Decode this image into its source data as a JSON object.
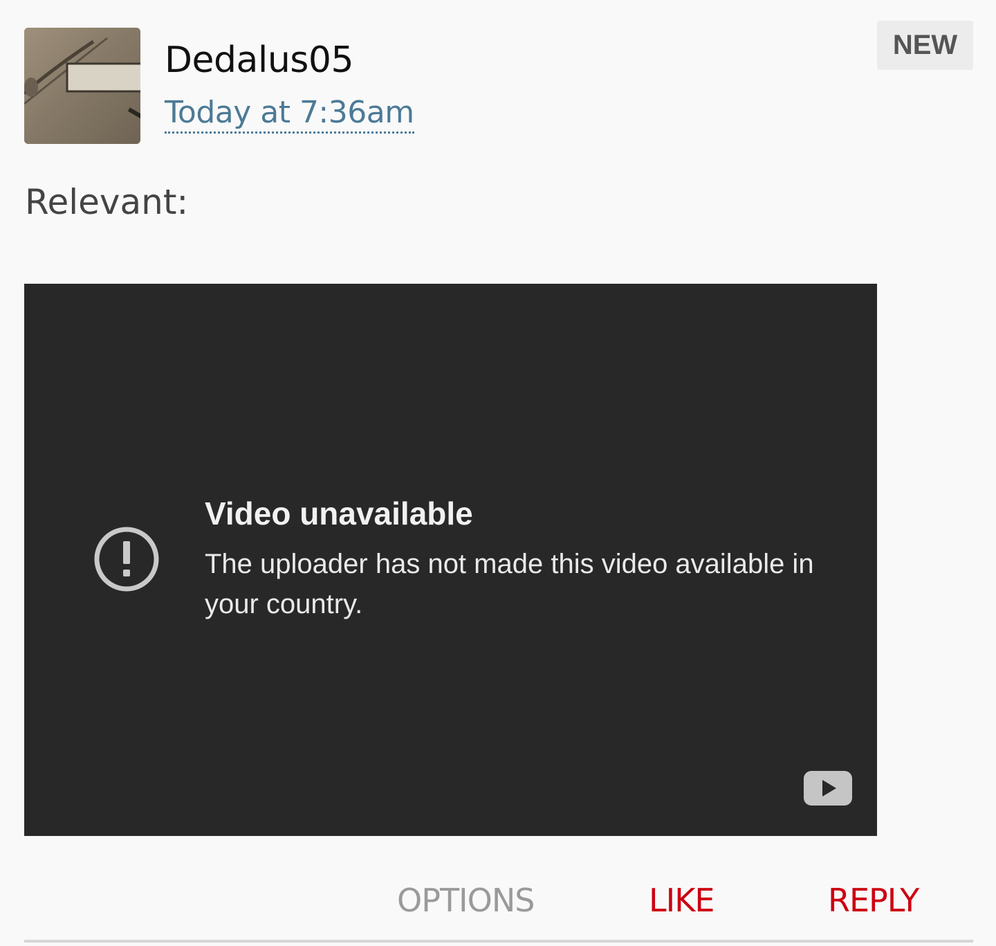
{
  "post": {
    "username": "Dedalus05",
    "timestamp": "Today at 7:36am",
    "badge": "NEW",
    "text": "Relevant:",
    "avatar_icon": "avatar-photo"
  },
  "video": {
    "title": "Video unavailable",
    "message": "The uploader has not made this video available in your country.",
    "status_icon": "exclamation-circle-icon",
    "logo_icon": "youtube-logo-icon"
  },
  "actions": {
    "options": "OPTIONS",
    "like": "LIKE",
    "reply": "REPLY"
  },
  "colors": {
    "background": "#f9f9f9",
    "link": "#4c7a96",
    "accent": "#cc0011",
    "muted": "#9a9a9a",
    "video_bg": "#282828"
  }
}
